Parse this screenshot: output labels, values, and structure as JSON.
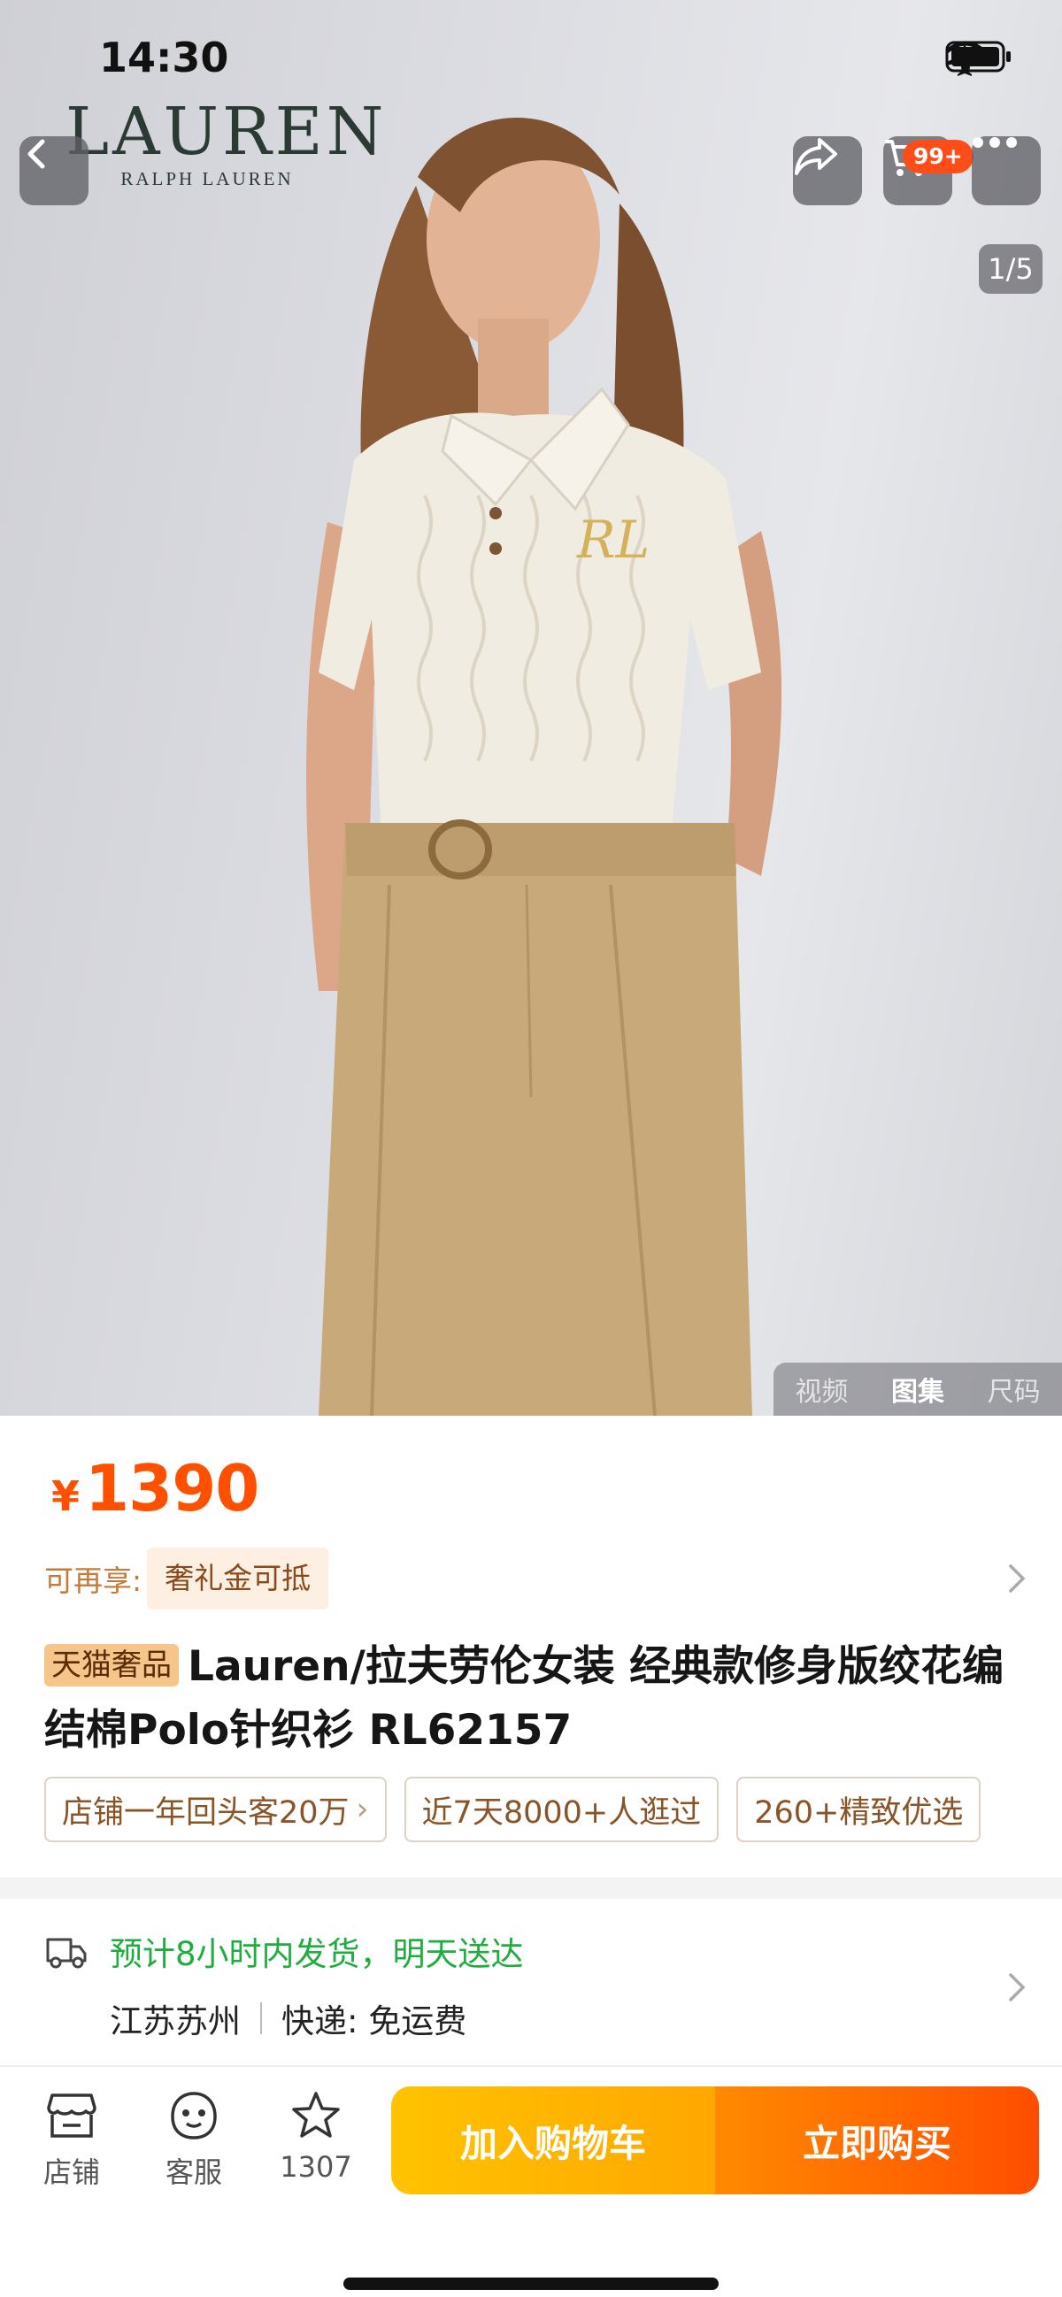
{
  "status_bar": {
    "time": "14:30"
  },
  "brand": {
    "name": "LAUREN",
    "sub": "RALPH LAUREN"
  },
  "nav": {
    "cart_badge": "99+",
    "page_indicator": "1/5"
  },
  "media_tabs": [
    "视频",
    "图集",
    "尺码"
  ],
  "price": {
    "symbol": "¥",
    "value": "1390"
  },
  "promo": {
    "label": "可再享:",
    "tag": "奢礼金可抵"
  },
  "product": {
    "badge": "天猫奢品",
    "title": "Lauren/拉夫劳伦女装 经典款修身版绞花编结棉Polo针织衫 RL62157"
  },
  "chips": [
    {
      "label": "店铺一年回头客20万",
      "arrow": "›"
    },
    {
      "label": "近7天8000+人逛过"
    },
    {
      "label": "260+精致优选"
    }
  ],
  "shipping": {
    "eta": "预计8小时内发货，明天送达",
    "origin": "江苏苏州",
    "delivery": "快递: 免运费"
  },
  "bottom_bar": {
    "store_label": "店铺",
    "service_label": "客服",
    "fav_count": "1307",
    "add_to_cart": "加入购物车",
    "buy_now": "立即购买"
  },
  "colors": {
    "accent": "#ff5000",
    "cart_gradient": "#ffc300",
    "buy_gradient": "#ff4d00",
    "eta_green": "#1fae3d"
  },
  "icons": [
    "back-icon",
    "share-icon",
    "cart-icon",
    "more-icon",
    "truck-icon",
    "store-icon",
    "service-icon",
    "star-icon",
    "chevron-right-icon",
    "airplane-icon",
    "wifi-icon",
    "battery-icon"
  ]
}
